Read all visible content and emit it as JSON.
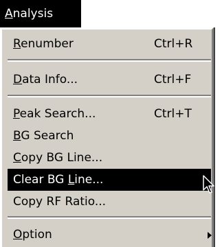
{
  "menu_title": {
    "prefix": "",
    "accel": "A",
    "rest": "nalysis"
  },
  "items": [
    {
      "accel": "R",
      "rest": "enumber",
      "shortcut": "Ctrl+R"
    },
    {
      "accel": "D",
      "rest": "ata Info...",
      "shortcut": "Ctrl+F"
    },
    {
      "accel": "P",
      "rest": "eak Search...",
      "shortcut": "Ctrl+T"
    },
    {
      "accel": "B",
      "rest": "G Search",
      "shortcut": ""
    },
    {
      "accel": "C",
      "rest": "opy BG Line...",
      "shortcut": ""
    },
    {
      "prefix": "Clear BG ",
      "accel": "L",
      "rest": "ine...",
      "shortcut": ""
    },
    {
      "prefix": "Copy RF Ratio...",
      "accel": "",
      "rest": "",
      "shortcut": ""
    },
    {
      "accel": "O",
      "rest": "ption",
      "shortcut": ""
    }
  ]
}
